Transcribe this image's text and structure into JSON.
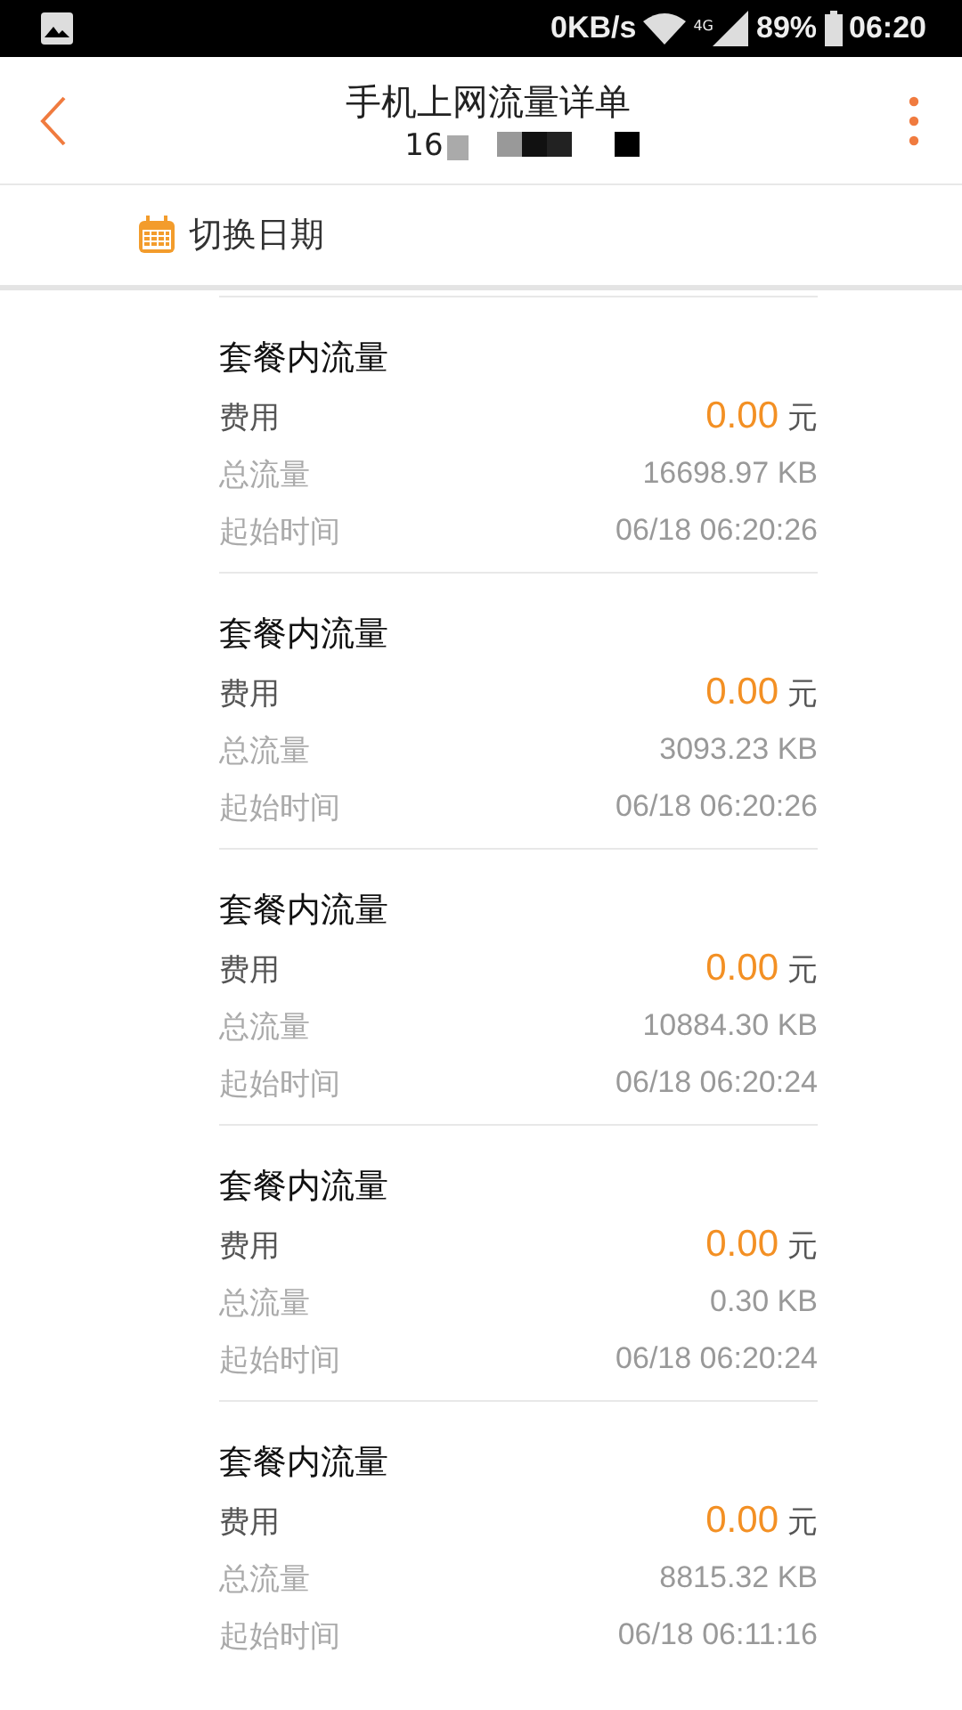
{
  "status_bar": {
    "speed": "0KB/s",
    "network": "4G",
    "battery": "89%",
    "time": "06:20"
  },
  "header": {
    "title": "手机上网流量详单",
    "subtitle": "16"
  },
  "date_switch": {
    "label": "切换日期"
  },
  "records": [
    {
      "title": "套餐内流量",
      "fee": {
        "label": "费用",
        "value": "0.00",
        "unit": "元"
      },
      "total": {
        "label": "总流量",
        "value": "16698.97 KB"
      },
      "start": {
        "label": "起始时间",
        "value": "06/18 06:20:26"
      }
    },
    {
      "title": "套餐内流量",
      "fee": {
        "label": "费用",
        "value": "0.00",
        "unit": "元"
      },
      "total": {
        "label": "总流量",
        "value": "3093.23 KB"
      },
      "start": {
        "label": "起始时间",
        "value": "06/18 06:20:26"
      }
    },
    {
      "title": "套餐内流量",
      "fee": {
        "label": "费用",
        "value": "0.00",
        "unit": "元"
      },
      "total": {
        "label": "总流量",
        "value": "10884.30 KB"
      },
      "start": {
        "label": "起始时间",
        "value": "06/18 06:20:24"
      }
    },
    {
      "title": "套餐内流量",
      "fee": {
        "label": "费用",
        "value": "0.00",
        "unit": "元"
      },
      "total": {
        "label": "总流量",
        "value": "0.30 KB"
      },
      "start": {
        "label": "起始时间",
        "value": "06/18 06:20:24"
      }
    },
    {
      "title": "套餐内流量",
      "fee": {
        "label": "费用",
        "value": "0.00",
        "unit": "元"
      },
      "total": {
        "label": "总流量",
        "value": "8815.32 KB"
      },
      "start": {
        "label": "起始时间",
        "value": "06/18 06:11:16"
      }
    }
  ]
}
